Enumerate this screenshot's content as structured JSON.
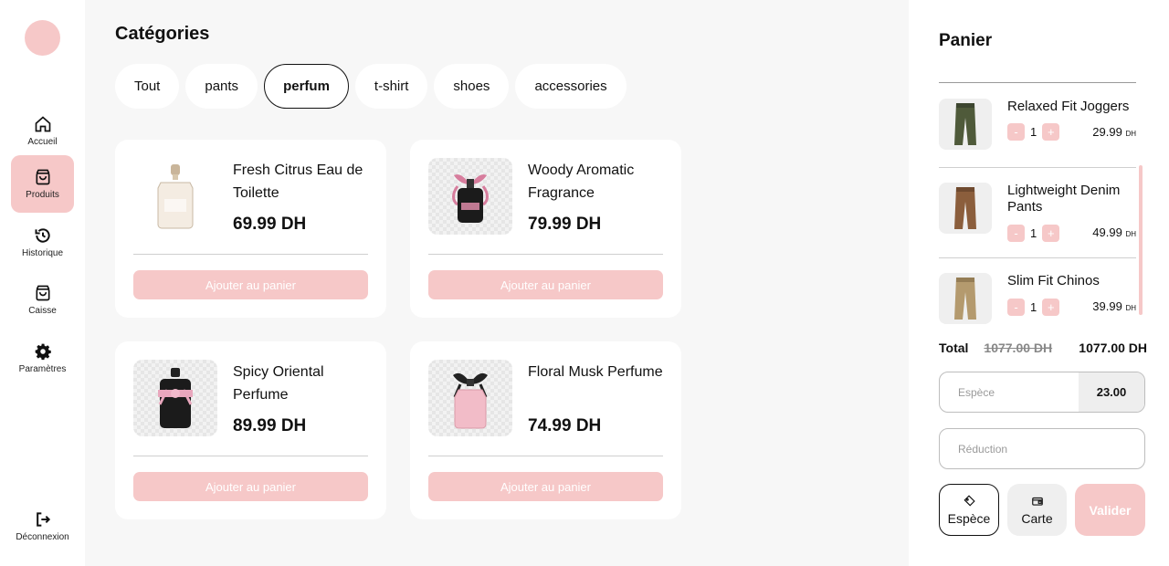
{
  "sidebar": {
    "items": [
      {
        "label": "Accueil",
        "icon": "home-icon"
      },
      {
        "label": "Produits",
        "icon": "bag-icon"
      },
      {
        "label": "Historique",
        "icon": "history-icon"
      },
      {
        "label": "Caisse",
        "icon": "bag-icon"
      },
      {
        "label": "Paramètres",
        "icon": "gear-icon"
      }
    ],
    "logout": {
      "label": "Déconnexion",
      "icon": "logout-icon"
    },
    "active": "Produits"
  },
  "main": {
    "title": "Catégories",
    "categories": [
      "Tout",
      "pants",
      "perfum",
      "t-shirt",
      "shoes",
      "accessories"
    ],
    "selected_category": "perfum",
    "products": [
      {
        "name": "Fresh Citrus Eau de Toilette",
        "price": "69.99 DH",
        "button": "Ajouter au panier"
      },
      {
        "name": "Woody Aromatic Fragrance",
        "price": "79.99 DH",
        "button": "Ajouter au panier"
      },
      {
        "name": "Spicy Oriental Perfume",
        "price": "89.99 DH",
        "button": "Ajouter au panier"
      },
      {
        "name": "Floral Musk Perfume",
        "price": "74.99 DH",
        "button": "Ajouter au panier"
      }
    ]
  },
  "cart": {
    "title": "Panier",
    "items": [
      {
        "name": "Relaxed Fit Joggers",
        "qty": "1",
        "price": "29.99",
        "currency": "DH",
        "minus": "-",
        "plus": "+"
      },
      {
        "name": "Lightweight Denim Pants",
        "qty": "1",
        "price": "49.99",
        "currency": "DH",
        "minus": "-",
        "plus": "+"
      },
      {
        "name": "Slim Fit Chinos",
        "qty": "1",
        "price": "39.99",
        "currency": "DH",
        "minus": "-",
        "plus": "+"
      }
    ],
    "total_label": "Total",
    "total_old": "1077.00 DH",
    "total_new": "1077.00 DH",
    "cash_label": "Espèce",
    "cash_value": "23.00",
    "discount_placeholder": "Réduction",
    "pay_cash": "Espèce",
    "pay_card": "Carte",
    "validate": "Valider"
  },
  "colors": {
    "accent": "#f6c8c8",
    "background": "#f7f7f7"
  }
}
